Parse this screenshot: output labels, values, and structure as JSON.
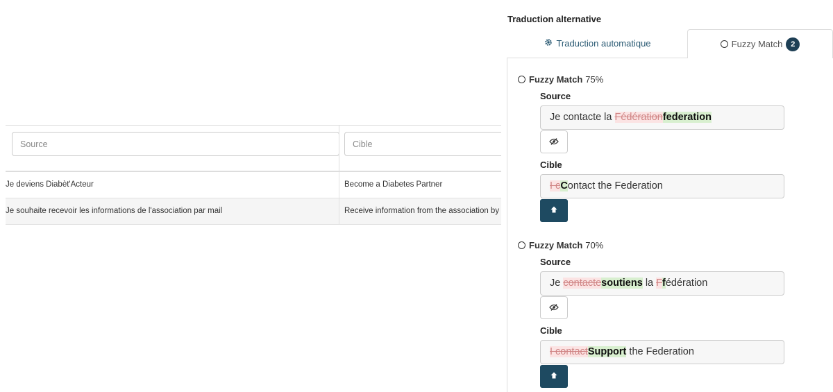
{
  "table": {
    "filters": {
      "source_placeholder": "Source",
      "cible_placeholder": "Cible"
    },
    "rows": [
      {
        "source": "Je deviens Diabèt'Acteur",
        "cible": "Become a Diabetes Partner"
      },
      {
        "source": "Je souhaite recevoir les informations de l'association par mail",
        "cible": "Receive information from the association by"
      }
    ]
  },
  "panel": {
    "title": "Traduction alternative",
    "tabs": {
      "auto_label": "Traduction automatique",
      "fuzzy_label": "Fuzzy Match",
      "fuzzy_count": "2"
    },
    "matches": [
      {
        "label": "Fuzzy Match",
        "percent": "75%",
        "source_label": "Source",
        "source": {
          "p1": "Je contacte la ",
          "del1": "Fédération",
          "ins1": "federation"
        },
        "cible_label": "Cible",
        "cible": {
          "del1": "I c",
          "ins1": "C",
          "p1": "ontact the Federation"
        }
      },
      {
        "label": "Fuzzy Match",
        "percent": "70%",
        "source_label": "Source",
        "source": {
          "p1": "Je ",
          "del1": "contacte",
          "ins1": "soutiens",
          "p2": " la ",
          "del2": "F",
          "ins2": "f",
          "p3": "édération"
        },
        "cible_label": "Cible",
        "cible": {
          "del1": "I contact",
          "ins1": "Support",
          "p1": " the Federation"
        }
      }
    ]
  },
  "colors": {
    "accent": "#1e4a61",
    "badge": "#1e3f55",
    "deleted_bg": "#fbe3e3",
    "inserted_bg": "#d8efcf"
  },
  "icons": {
    "auto_tab": "gear-icon",
    "fuzzy_tab": "circle-icon",
    "eye": "eye-slash-icon",
    "copy": "arrow-up-icon"
  }
}
